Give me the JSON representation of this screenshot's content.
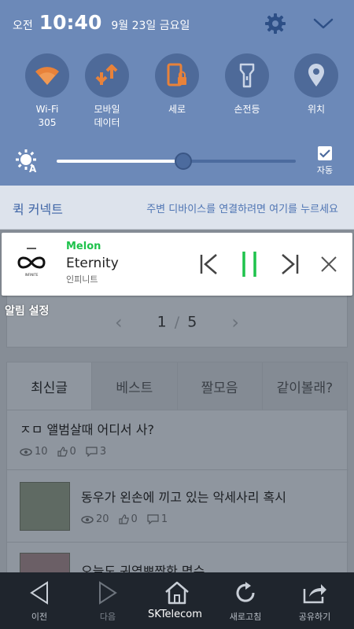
{
  "status": {
    "ampm": "오전",
    "time": "10:40",
    "date": "9월 23일 금요일"
  },
  "quick_settings": [
    {
      "id": "wifi",
      "label": "Wi-Fi\n305",
      "icon": "wifi-icon",
      "active": true
    },
    {
      "id": "mobile-data",
      "label": "모바일\n데이터",
      "icon": "data-transfer-icon",
      "active": true
    },
    {
      "id": "rotation",
      "label": "세로",
      "icon": "rotation-lock-icon",
      "active": true
    },
    {
      "id": "flashlight",
      "label": "손전등",
      "icon": "flashlight-icon",
      "active": false
    },
    {
      "id": "location",
      "label": "위치",
      "icon": "location-pin-icon",
      "active": false
    }
  ],
  "brightness": {
    "level": 0.53,
    "auto_label": "자동",
    "auto_checked": true
  },
  "quick_connect": {
    "title": "퀵 커넥트",
    "description": "주변 디바이스를 연결하려면 여기를 누르세요"
  },
  "media": {
    "app": "Melon",
    "track": "Eternity",
    "artist": "인피니트",
    "accent": "#1ec24b"
  },
  "notification_settings_label": "알림 설정",
  "page": {
    "pager": {
      "current": "1",
      "separator": "/",
      "total": "5"
    },
    "tabs": [
      "최신글",
      "베스트",
      "짤모음",
      "같이볼래?"
    ],
    "posts": [
      {
        "title": "ㅈㅁ 앨범살때 어디서 사?",
        "views": "10",
        "likes": "0",
        "comments": "3"
      },
      {
        "title": "동우가 왼손에 끼고 있는 악세사리 혹시",
        "views": "20",
        "likes": "0",
        "comments": "1"
      },
      {
        "title": "오늘도 귀염뽀짝한 명수"
      }
    ]
  },
  "toolbar": {
    "items": [
      {
        "label": "이전",
        "icon": "back-arrow-icon",
        "enabled": true
      },
      {
        "label": "다음",
        "icon": "forward-arrow-icon",
        "enabled": false
      },
      {
        "label": "",
        "icon": "home-icon",
        "enabled": true
      },
      {
        "label": "새로고침",
        "icon": "refresh-icon",
        "enabled": true
      },
      {
        "label": "공유하기",
        "icon": "share-icon",
        "enabled": true
      }
    ],
    "carrier": "SKTelecom"
  }
}
